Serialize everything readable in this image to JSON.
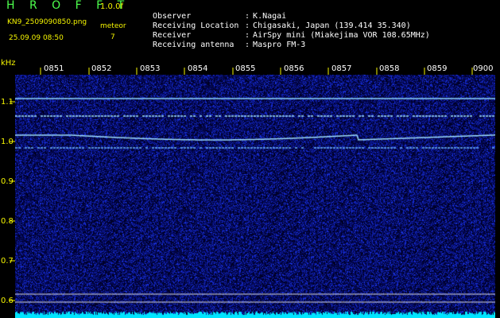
{
  "header": {
    "brand": "H R O F F T",
    "version": "1.0.0f",
    "filename": "KN9_2509090850.png",
    "meteor_label": "meteor",
    "datetime": "25.09.09 08:50",
    "meteor_count": "7"
  },
  "meta": [
    {
      "key": "Observer",
      "value": "K.Nagai"
    },
    {
      "key": "Receiving Location",
      "value": "Chigasaki, Japan (139.414 35.340)"
    },
    {
      "key": "Receiver",
      "value": "AirSpy mini (Miakejima VOR 108.65MHz)"
    },
    {
      "key": "Receiving antenna",
      "value": "Maspro FM-3"
    }
  ],
  "axis": {
    "y_unit": "kHz",
    "y_ticks": [
      "1.1",
      "1.0",
      "0.9",
      "0.8",
      "0.7",
      "0.6"
    ],
    "x_ticks": [
      "0851",
      "0852",
      "0853",
      "0854",
      "0855",
      "0856",
      "0857",
      "0858",
      "0859",
      "0900"
    ]
  },
  "colors": {
    "background": "#000000",
    "noise": "#1a2bd6",
    "signal": "#bfefff",
    "label_yellow": "#f5f500"
  }
}
